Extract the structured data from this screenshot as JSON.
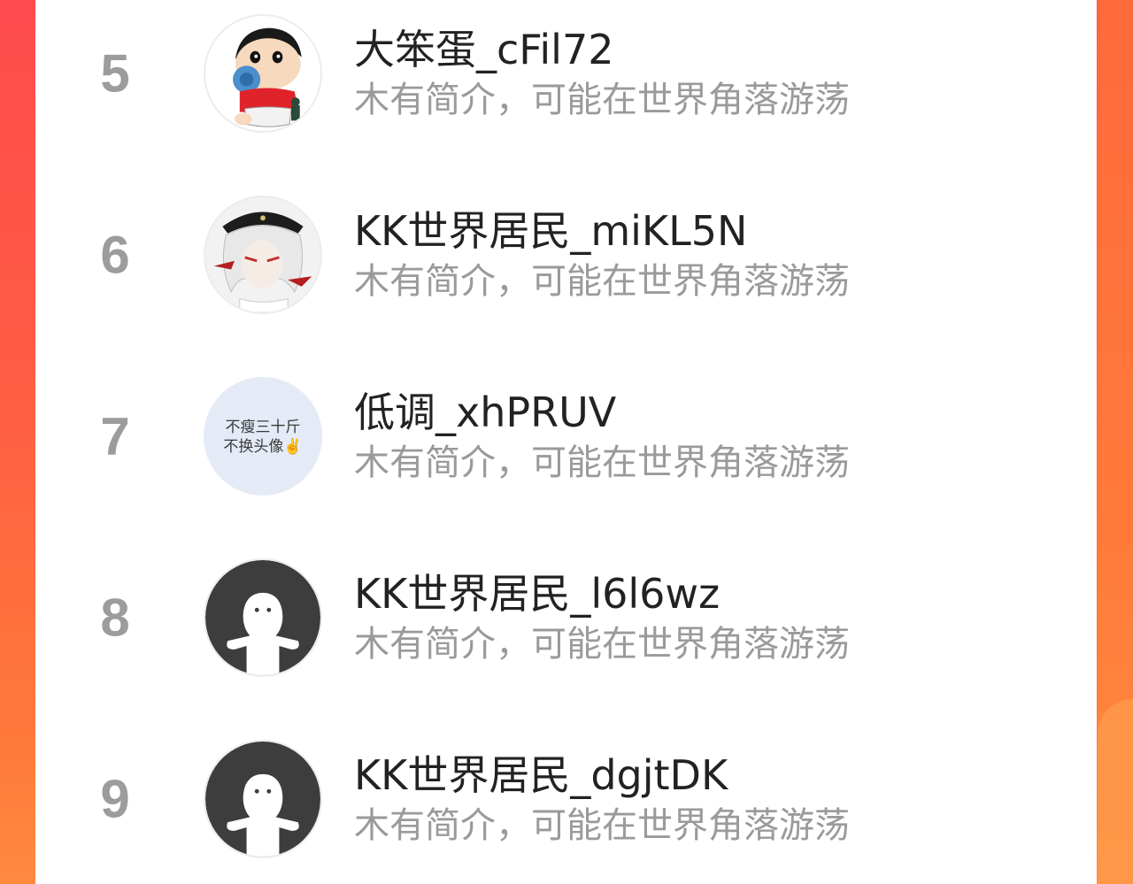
{
  "list": {
    "items": [
      {
        "rank": "5",
        "name": "大笨蛋_cFil72",
        "bio": "木有简介，可能在世界角落游荡",
        "avatar_icon": "cartoon-boy-avatar-icon"
      },
      {
        "rank": "6",
        "name": "KK世界居民_miKL5N",
        "bio": "木有简介，可能在世界角落游荡",
        "avatar_icon": "anime-character-avatar-icon"
      },
      {
        "rank": "7",
        "name": "低调_xhPRUV",
        "bio": "木有简介，可能在世界角落游荡",
        "avatar_text_line1": "不瘦三十斤",
        "avatar_text_line2": "不换头像✌",
        "avatar_icon": "text-avatar-icon"
      },
      {
        "rank": "8",
        "name": "KK世界居民_l6l6wz",
        "bio": "木有简介，可能在世界角落游荡",
        "avatar_icon": "default-ghost-avatar-icon"
      },
      {
        "rank": "9",
        "name": "KK世界居民_dgjtDK",
        "bio": "木有简介，可能在世界角落游荡",
        "avatar_icon": "default-ghost-avatar-icon"
      }
    ]
  },
  "colors": {
    "background_gradient_top": "#ff4a4e",
    "background_gradient_bottom": "#ff8a3e",
    "rank_color": "#9c9c9c",
    "name_color": "#222222",
    "bio_color": "#9a9a9a",
    "default_avatar_bg": "#3d3d3d"
  }
}
